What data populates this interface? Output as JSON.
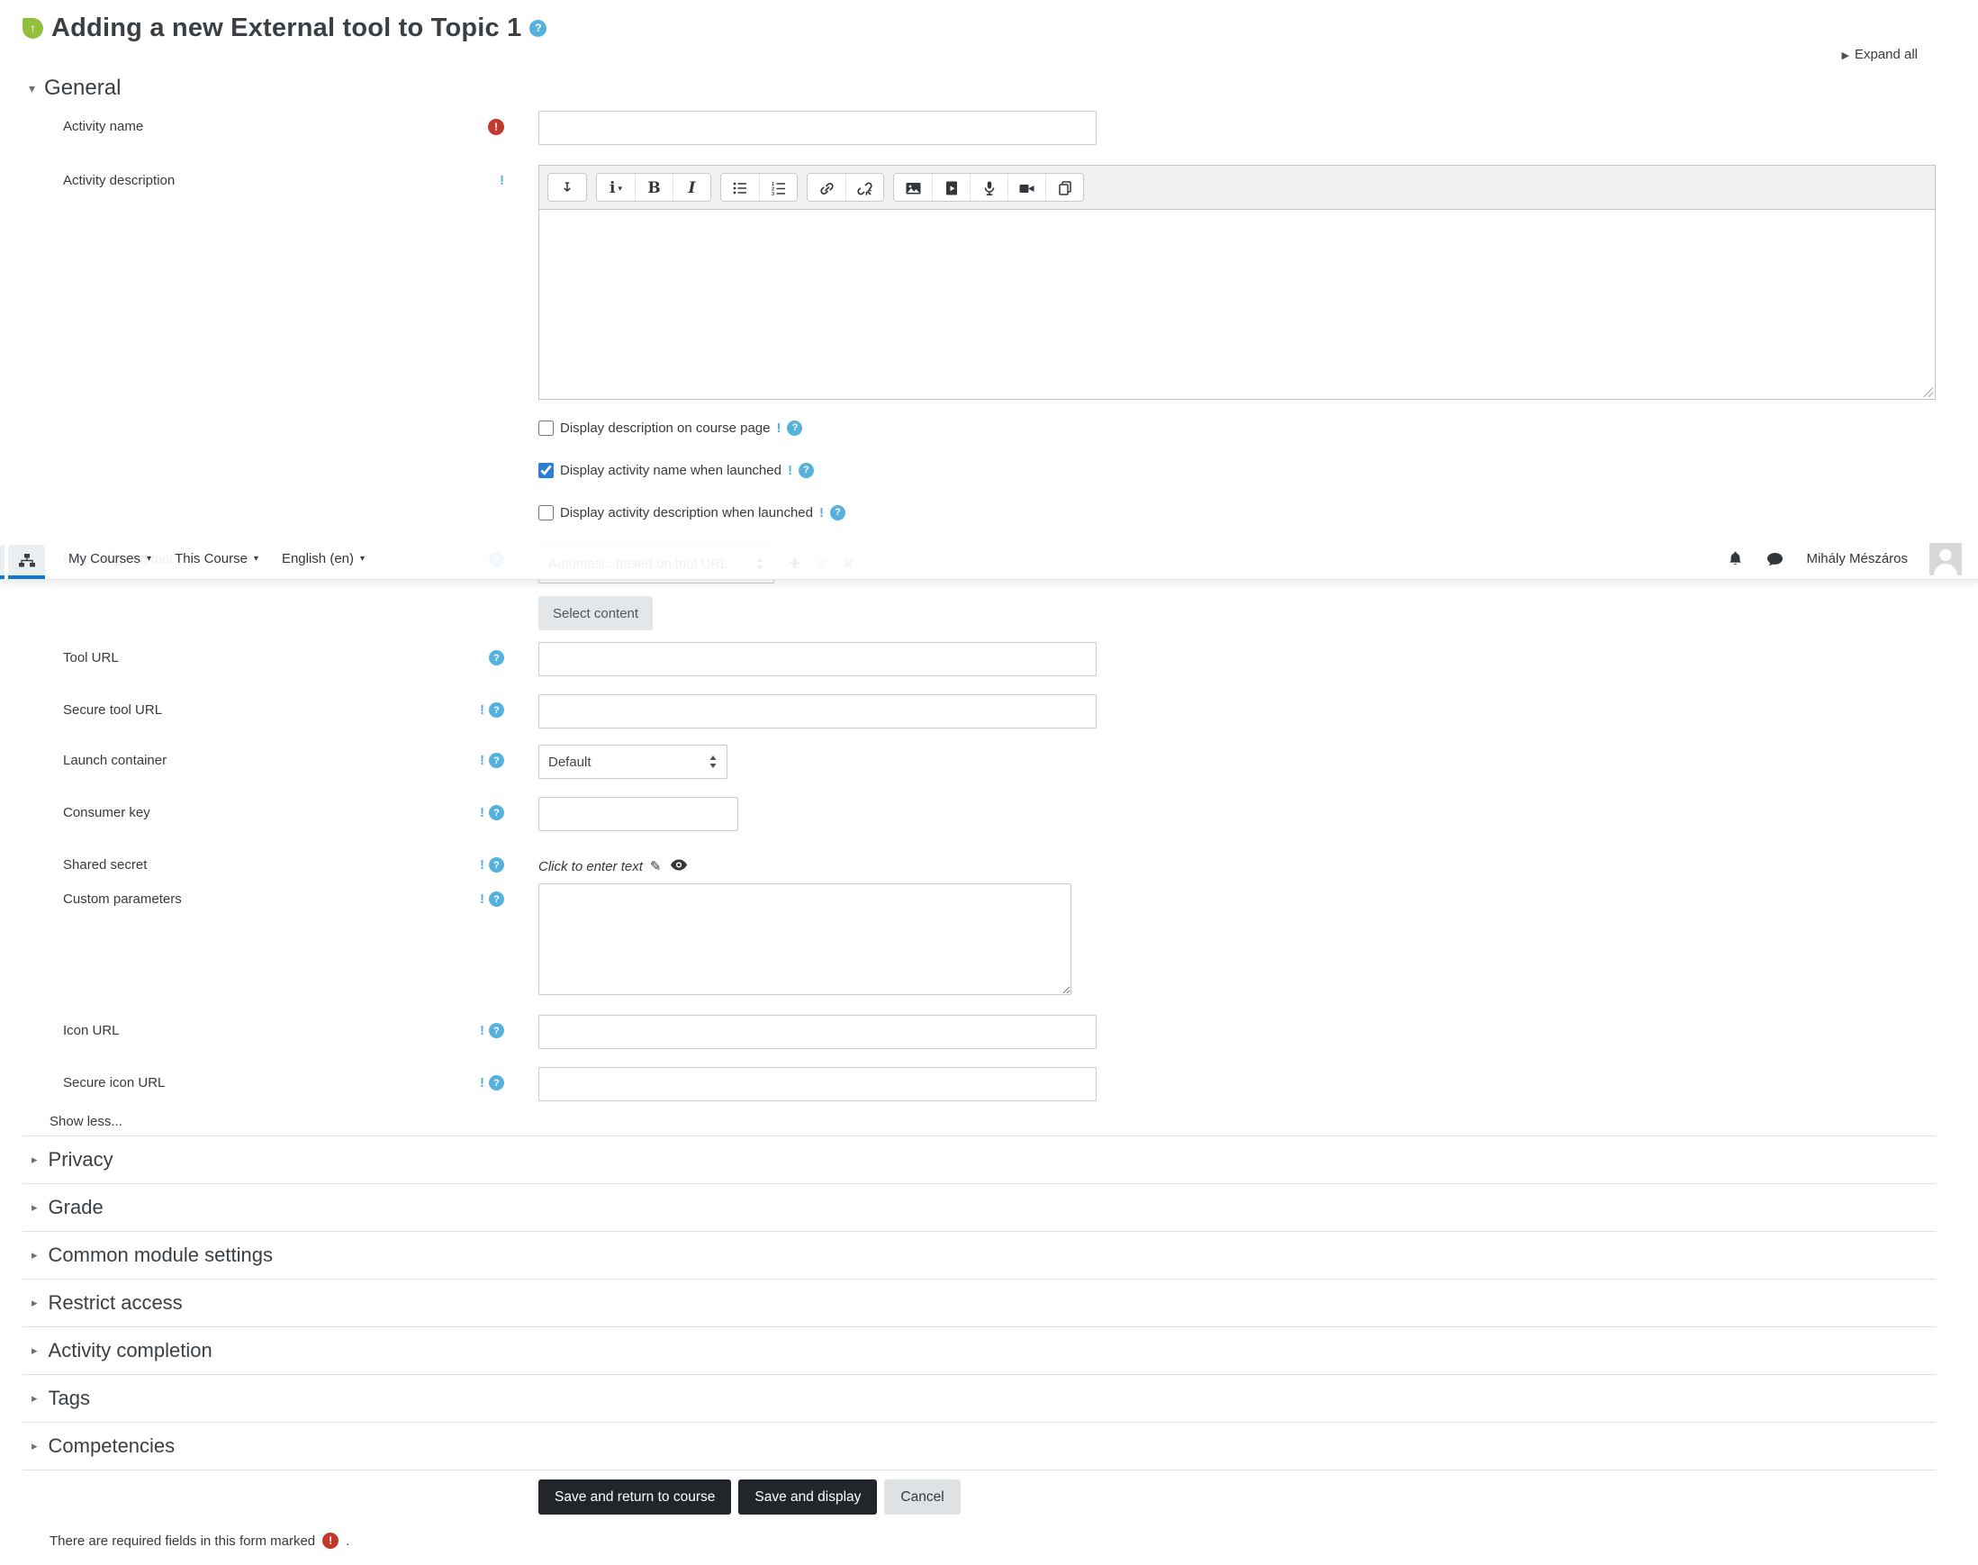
{
  "page": {
    "title": "Adding a new External tool to Topic 1",
    "expand_all": "Expand all",
    "show_less": "Show less...",
    "required_note": "There are required fields in this form marked",
    "required_note_suffix": "."
  },
  "navbar": {
    "menus": [
      {
        "label": "My Courses"
      },
      {
        "label": "This Course"
      },
      {
        "label": "English (en)"
      }
    ],
    "icons": [
      "sitemap-icon",
      "bell-icon",
      "chat-icon"
    ],
    "user_name": "Mihály Mészáros"
  },
  "form": {
    "section_general": "General",
    "activity_name_label": "Activity name",
    "activity_description_label": "Activity description",
    "editor_toolbar_icons": [
      "collapse-toolbar-icon",
      "paragraph-style-icon",
      "bold-icon",
      "italic-icon",
      "unordered-list-icon",
      "ordered-list-icon",
      "link-icon",
      "unlink-icon",
      "insert-image-icon",
      "insert-media-icon",
      "record-audio-icon",
      "record-video-icon",
      "manage-files-icon"
    ],
    "checkboxes": [
      {
        "label": "Display description on course page",
        "checked": false
      },
      {
        "label": "Display activity name when launched",
        "checked": true
      },
      {
        "label": "Display activity description when launched",
        "checked": false
      }
    ],
    "preconfigured_tool_label": "Preconfigured tool",
    "preconfigured_tool_selected": "Automatic, based on tool URL",
    "select_content_button": "Select content",
    "tool_url_label": "Tool URL",
    "secure_tool_url_label": "Secure tool URL",
    "launch_container_label": "Launch container",
    "launch_container_selected": "Default",
    "consumer_key_label": "Consumer key",
    "shared_secret_label": "Shared secret",
    "shared_secret_placeholder": "Click to enter text",
    "custom_parameters_label": "Custom parameters",
    "icon_url_label": "Icon URL",
    "secure_icon_url_label": "Secure icon URL"
  },
  "sections": [
    {
      "title": "Privacy"
    },
    {
      "title": "Grade"
    },
    {
      "title": "Common module settings"
    },
    {
      "title": "Restrict access"
    },
    {
      "title": "Activity completion"
    },
    {
      "title": "Tags"
    },
    {
      "title": "Competencies"
    }
  ],
  "actions": {
    "save_return": "Save and return to course",
    "save_display": "Save and display",
    "cancel": "Cancel"
  },
  "colors": {
    "primary_tab_underline": "#1177d1",
    "help_icon_blue": "#56b2dc",
    "required_icon_red": "#c2392e",
    "tool_icon_green": "#93c03c",
    "dark_button": "#22262a"
  }
}
